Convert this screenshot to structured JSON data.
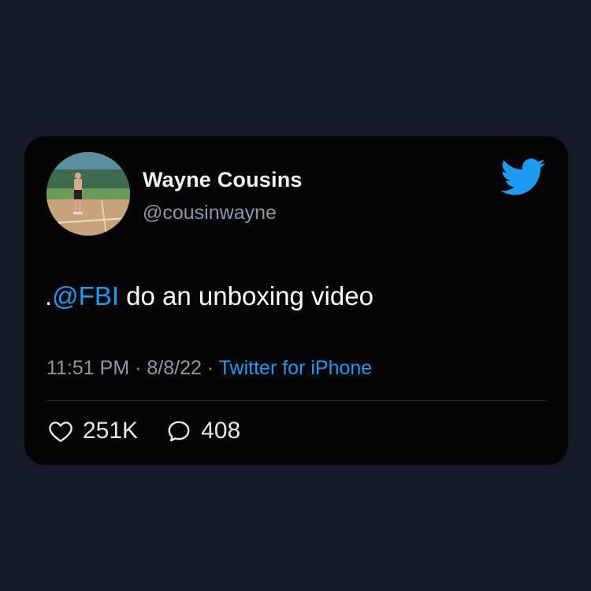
{
  "tweet": {
    "author": {
      "display_name": "Wayne Cousins",
      "handle": "@cousinwayne",
      "avatar_icon": "avatar-photo"
    },
    "brand_icon": "twitter-bird-icon",
    "brand_color": "#1d9bf0",
    "text": {
      "prefix": ".",
      "mention": "@FBI",
      "body": " do an unboxing video"
    },
    "meta": {
      "time": "11:51 PM",
      "separator_1": " · ",
      "date": "8/8/22",
      "separator_2": " · ",
      "source": "Twitter for iPhone"
    },
    "stats": {
      "likes_icon": "heart-icon",
      "likes": "251K",
      "replies_icon": "reply-bubble-icon",
      "replies": "408"
    }
  },
  "colors": {
    "page_background": "#161a26",
    "card_background": "#050505",
    "accent": "#1d9bf0",
    "muted_text": "#8b98a5"
  }
}
